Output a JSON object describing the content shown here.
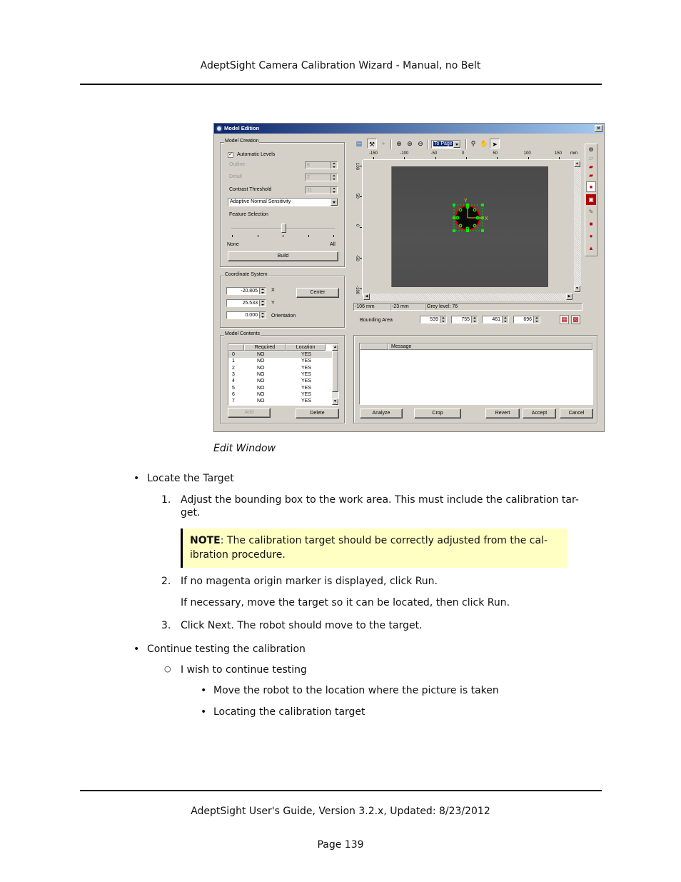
{
  "page": {
    "header": "AdeptSight Camera Calibration Wizard - Manual, no Belt",
    "footer": "AdeptSight User's Guide,  Version 3.2.x, Updated: 8/23/2012",
    "page_number": "Page 139",
    "caption": "Edit Window"
  },
  "dialog": {
    "title": "Model Edition",
    "close_glyph": "×",
    "model_creation": {
      "label": "Model Creation",
      "automatic_levels": {
        "label": "Automatic Levels",
        "checked": true,
        "glyph": "✓"
      },
      "outline": {
        "label": "Outline",
        "value": "6"
      },
      "detail": {
        "label": "Detail",
        "value": "2"
      },
      "contrast_threshold": {
        "label": "Contrast Threshold",
        "value": "11"
      },
      "sensitivity": {
        "value": "Adaptive Normal Sensitivity"
      },
      "feature_selection": {
        "label": "Feature Selection",
        "min_label": "None",
        "max_label": "All",
        "value_fraction": 0.5
      },
      "build_label": "Build"
    },
    "coordinate_system": {
      "label": "Coordinate System",
      "x": {
        "value": "-20.805",
        "label": "X"
      },
      "y": {
        "value": "25.533",
        "label": "Y"
      },
      "orientation": {
        "value": "0.000",
        "label": "Orientation"
      },
      "center_label": "Center"
    },
    "model_contents": {
      "label": "Model Contents",
      "columns": [
        "",
        "Required",
        "Location"
      ],
      "rows": [
        [
          "0",
          "NO",
          "YES"
        ],
        [
          "1",
          "NO",
          "YES"
        ],
        [
          "2",
          "NO",
          "YES"
        ],
        [
          "3",
          "NO",
          "YES"
        ],
        [
          "4",
          "NO",
          "YES"
        ],
        [
          "5",
          "NO",
          "YES"
        ],
        [
          "6",
          "NO",
          "YES"
        ],
        [
          "7",
          "NO",
          "YES"
        ]
      ],
      "add_label": "Add",
      "delete_label": "Delete"
    },
    "toolbar": {
      "zoom_mode": "To Page",
      "icons": [
        "display-options",
        "tools",
        "crosshair",
        "zoom-in",
        "zoom-fit",
        "zoom-out",
        "magnifier",
        "pan-hand",
        "pointer"
      ]
    },
    "ruler": {
      "x_ticks": [
        "-150",
        "-100",
        "-50",
        "0",
        "50",
        "100",
        "150"
      ],
      "x_unit": "mm",
      "y_ticks": [
        "100",
        "50",
        "0",
        "-50",
        "-100"
      ]
    },
    "status": {
      "x": "-106 mm",
      "y": "-23 mm",
      "grey": "Grey level: 76"
    },
    "bounding_area": {
      "label": "Bounding Area",
      "values": [
        "539",
        "755",
        "461",
        "696"
      ]
    },
    "messages": {
      "columns": [
        "",
        "Message"
      ]
    },
    "buttons": {
      "analyze": "Analyze",
      "crop": "Crop",
      "revert": "Revert",
      "accept": "Accept",
      "cancel": "Cancel"
    },
    "right_tools": [
      "pick-model",
      "plane-outline",
      "plane-filled",
      "plane-with-arrow",
      "fit-corners",
      "bounding-area",
      "eraser",
      "square",
      "circle",
      "polygon"
    ]
  },
  "content": {
    "bullet1": "Locate the Target",
    "step1": "Adjust the bounding box to the work area. This must include the calibration tar-",
    "step1_cont": "get.",
    "note_label": "NOTE",
    "note_text1": ": The calibration target should be correctly adjusted from the cal-",
    "note_text2": "ibration procedure.",
    "step2": "If no magenta origin marker is displayed, click Run.",
    "step2_cont": "If necessary, move the target so it can be located, then click Run.",
    "step3": "Click Next. The robot should move to the target.",
    "bullet2": "Continue testing the calibration",
    "sub1": "I wish to continue testing",
    "sub_sub": [
      "Move the robot to the location where the picture is taken",
      "Locating the calibration target"
    ],
    "num1": "1.",
    "num2": "2.",
    "num3": "3.",
    "bullet_glyph": "•",
    "circle_glyph": "○"
  }
}
